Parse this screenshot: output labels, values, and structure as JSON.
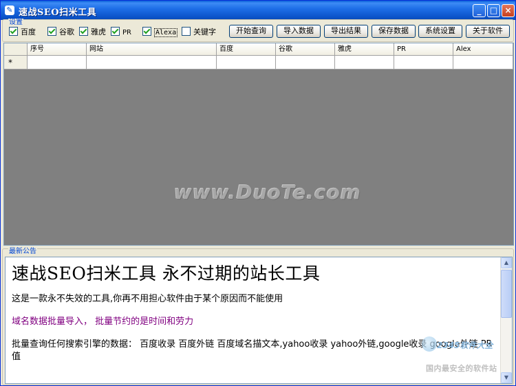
{
  "window": {
    "title": "速战SEO扫米工具",
    "controls": {
      "minimize": "_",
      "maximize": "□",
      "close": "×"
    }
  },
  "settings": {
    "label": "设置",
    "checkboxes": [
      {
        "label": "百度",
        "checked": true
      },
      {
        "label": "谷歌",
        "checked": true
      },
      {
        "label": "雅虎",
        "checked": true
      },
      {
        "label": "PR",
        "checked": true
      },
      {
        "label": "Alexa",
        "checked": true
      },
      {
        "label": "关键字",
        "checked": false
      }
    ],
    "buttons": [
      "开始查询",
      "导入数据",
      "导出结果",
      "保存数据",
      "系统设置",
      "关于软件"
    ]
  },
  "grid": {
    "columns": [
      "序号",
      "网站",
      "百度",
      "谷歌",
      "雅虎",
      "PR",
      "Alex"
    ],
    "new_row_marker": "*"
  },
  "watermark": "www.DuoTe.com",
  "notice": {
    "label": "最新公告",
    "heading": "速战SEO扫米工具  永不过期的站长工具",
    "line1": "这是一款永不失效的工具,你再不用担心软件由于某个原因而不能使用",
    "line2": "域名数据批量导入， 批量节约的是时间和劳力",
    "line3": "批量查询任何搜索引擎的数据： 百度收录  百度外链  百度域名描文本,yahoo收录  yahoo外链,google收录  google外链 PR值"
  },
  "corner_logo": {
    "brand": "2345软件大全",
    "slogan": "国内最安全的软件站"
  },
  "colors": {
    "titlebar": "#0b53c9",
    "window_bg": "#ece9d8",
    "grid_bg": "#808080",
    "group_label": "#0046d5",
    "notice_purple": "#800080"
  }
}
